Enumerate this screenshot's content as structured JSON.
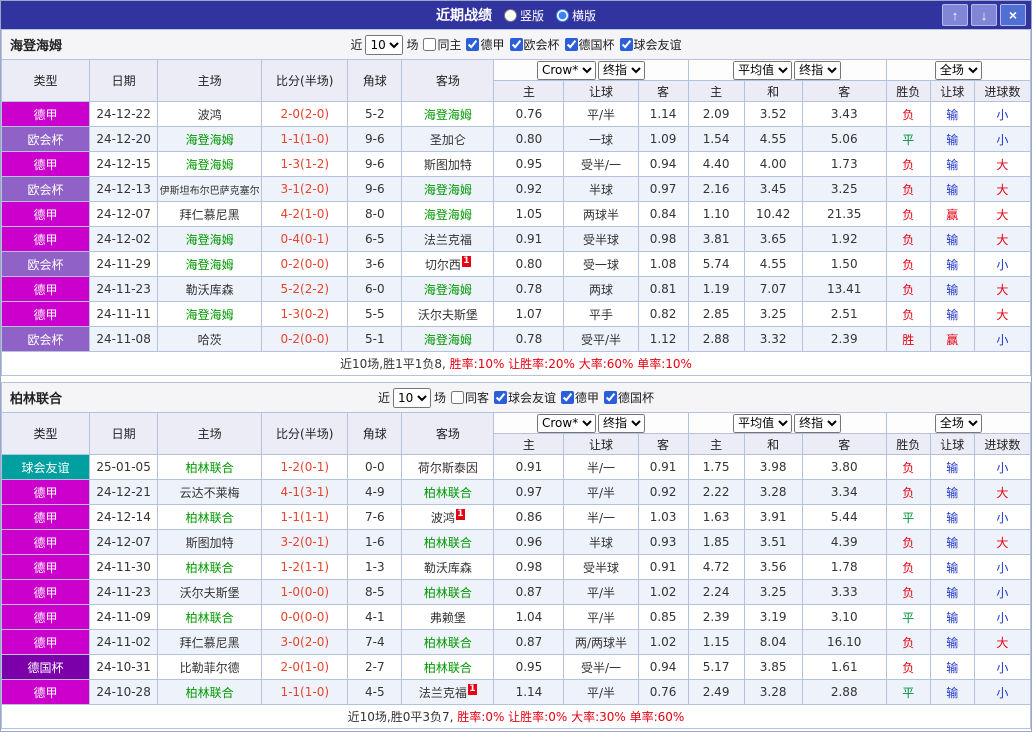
{
  "titlebar": {
    "title": "近期战绩",
    "radios": [
      {
        "label": "竖版",
        "selected": false
      },
      {
        "label": "横版",
        "selected": true
      }
    ],
    "buttons": {
      "up": "↑",
      "down": "↓",
      "close": "×"
    }
  },
  "colors": {
    "league": {
      "德甲": "#cc00cc",
      "欧会杯": "#9062c8",
      "德国杯": "#7b00aa",
      "球会友谊": "#00a0a0"
    },
    "team_highlight": "#009900",
    "score": "#e8432c",
    "result_map": {
      "胜": "red",
      "平": "green",
      "负": "red",
      "赢": "red",
      "输": "blue",
      "大": "red",
      "小": "blue"
    }
  },
  "table_header": {
    "static_cols": [
      "类型",
      "日期",
      "主场",
      "比分(半场)",
      "角球",
      "客场"
    ],
    "odds_groups": [
      {
        "selects": [
          "Crow*",
          "终指"
        ],
        "cols": [
          "主",
          "让球",
          "客"
        ]
      },
      {
        "selects": [
          "平均值",
          "终指"
        ],
        "cols": [
          "主",
          "和",
          "客"
        ]
      },
      {
        "selects": [
          "全场"
        ],
        "cols": [
          "胜负",
          "让球",
          "进球数"
        ]
      }
    ]
  },
  "sections": [
    {
      "team": "海登海姆",
      "filter": {
        "near_label": "近",
        "count": "10",
        "games_label": "场",
        "same_venue": {
          "label": "同主",
          "checked": false
        },
        "leagues": [
          {
            "label": "德甲",
            "checked": true
          },
          {
            "label": "欧会杯",
            "checked": true
          },
          {
            "label": "德国杯",
            "checked": true
          },
          {
            "label": "球会友谊",
            "checked": true
          }
        ]
      },
      "rows": [
        {
          "league": "德甲",
          "date": "24-12-22",
          "home": "波鸿",
          "home_hl": false,
          "score": "2-0(2-0)",
          "corner": "5-2",
          "away": "海登海姆",
          "away_hl": true,
          "crown": [
            "0.76",
            "平/半",
            "1.14"
          ],
          "avg": [
            "2.09",
            "3.52",
            "3.43"
          ],
          "result": [
            "负",
            "输",
            "小"
          ]
        },
        {
          "league": "欧会杯",
          "date": "24-12-20",
          "home": "海登海姆",
          "home_hl": true,
          "score": "1-1(1-0)",
          "corner": "9-6",
          "away": "圣加仑",
          "away_hl": false,
          "crown": [
            "0.80",
            "一球",
            "1.09"
          ],
          "avg": [
            "1.54",
            "4.55",
            "5.06"
          ],
          "result": [
            "平",
            "输",
            "小"
          ]
        },
        {
          "league": "德甲",
          "date": "24-12-15",
          "home": "海登海姆",
          "home_hl": true,
          "score": "1-3(1-2)",
          "corner": "9-6",
          "away": "斯图加特",
          "away_hl": false,
          "crown": [
            "0.95",
            "受半/一",
            "0.94"
          ],
          "avg": [
            "4.40",
            "4.00",
            "1.73"
          ],
          "result": [
            "负",
            "输",
            "大"
          ]
        },
        {
          "league": "欧会杯",
          "date": "24-12-13",
          "home": "伊斯坦布尔巴萨克塞尔",
          "home_hl": false,
          "score": "3-1(2-0)",
          "corner": "9-6",
          "away": "海登海姆",
          "away_hl": true,
          "crown": [
            "0.92",
            "半球",
            "0.97"
          ],
          "avg": [
            "2.16",
            "3.45",
            "3.25"
          ],
          "result": [
            "负",
            "输",
            "大"
          ]
        },
        {
          "league": "德甲",
          "date": "24-12-07",
          "home": "拜仁慕尼黑",
          "home_hl": false,
          "score": "4-2(1-0)",
          "corner": "8-0",
          "away": "海登海姆",
          "away_hl": true,
          "crown": [
            "1.05",
            "两球半",
            "0.84"
          ],
          "avg": [
            "1.10",
            "10.42",
            "21.35"
          ],
          "result": [
            "负",
            "赢",
            "大"
          ]
        },
        {
          "league": "德甲",
          "date": "24-12-02",
          "home": "海登海姆",
          "home_hl": true,
          "score": "0-4(0-1)",
          "corner": "6-5",
          "away": "法兰克福",
          "away_hl": false,
          "crown": [
            "0.91",
            "受半球",
            "0.98"
          ],
          "avg": [
            "3.81",
            "3.65",
            "1.92"
          ],
          "result": [
            "负",
            "输",
            "大"
          ]
        },
        {
          "league": "欧会杯",
          "date": "24-11-29",
          "home": "海登海姆",
          "home_hl": true,
          "score": "0-2(0-0)",
          "corner": "3-6",
          "away": "切尔西",
          "away_hl": false,
          "away_rc": "1",
          "crown": [
            "0.80",
            "受一球",
            "1.08"
          ],
          "avg": [
            "5.74",
            "4.55",
            "1.50"
          ],
          "result": [
            "负",
            "输",
            "小"
          ]
        },
        {
          "league": "德甲",
          "date": "24-11-23",
          "home": "勒沃库森",
          "home_hl": false,
          "score": "5-2(2-2)",
          "corner": "6-0",
          "away": "海登海姆",
          "away_hl": true,
          "crown": [
            "0.78",
            "两球",
            "0.81"
          ],
          "avg": [
            "1.19",
            "7.07",
            "13.41"
          ],
          "result": [
            "负",
            "输",
            "大"
          ]
        },
        {
          "league": "德甲",
          "date": "24-11-11",
          "home": "海登海姆",
          "home_hl": true,
          "score": "1-3(0-2)",
          "corner": "5-5",
          "away": "沃尔夫斯堡",
          "away_hl": false,
          "crown": [
            "1.07",
            "平手",
            "0.82"
          ],
          "avg": [
            "2.85",
            "3.25",
            "2.51"
          ],
          "result": [
            "负",
            "输",
            "大"
          ]
        },
        {
          "league": "欧会杯",
          "date": "24-11-08",
          "home": "哈茨",
          "home_hl": false,
          "score": "0-2(0-0)",
          "corner": "5-1",
          "away": "海登海姆",
          "away_hl": true,
          "crown": [
            "0.78",
            "受平/半",
            "1.12"
          ],
          "avg": [
            "2.88",
            "3.32",
            "2.39"
          ],
          "result": [
            "胜",
            "赢",
            "小"
          ]
        }
      ],
      "summary": {
        "record": "近10场,胜1平1负8,",
        "rates": "胜率:10% 让胜率:20% 大率:60% 单率:10%"
      }
    },
    {
      "team": "柏林联合",
      "filter": {
        "near_label": "近",
        "count": "10",
        "games_label": "场",
        "same_venue": {
          "label": "同客",
          "checked": false
        },
        "leagues": [
          {
            "label": "球会友谊",
            "checked": true
          },
          {
            "label": "德甲",
            "checked": true
          },
          {
            "label": "德国杯",
            "checked": true
          }
        ]
      },
      "rows": [
        {
          "league": "球会友谊",
          "date": "25-01-05",
          "home": "柏林联合",
          "home_hl": true,
          "score": "1-2(0-1)",
          "corner": "0-0",
          "away": "荷尔斯泰因",
          "away_hl": false,
          "crown": [
            "0.91",
            "半/一",
            "0.91"
          ],
          "avg": [
            "1.75",
            "3.98",
            "3.80"
          ],
          "result": [
            "负",
            "输",
            "小"
          ]
        },
        {
          "league": "德甲",
          "date": "24-12-21",
          "home": "云达不莱梅",
          "home_hl": false,
          "score": "4-1(3-1)",
          "corner": "4-9",
          "away": "柏林联合",
          "away_hl": true,
          "crown": [
            "0.97",
            "平/半",
            "0.92"
          ],
          "avg": [
            "2.22",
            "3.28",
            "3.34"
          ],
          "result": [
            "负",
            "输",
            "大"
          ]
        },
        {
          "league": "德甲",
          "date": "24-12-14",
          "home": "柏林联合",
          "home_hl": true,
          "score": "1-1(1-1)",
          "corner": "7-6",
          "away": "波鸿",
          "away_hl": false,
          "away_rc": "1",
          "crown": [
            "0.86",
            "半/一",
            "1.03"
          ],
          "avg": [
            "1.63",
            "3.91",
            "5.44"
          ],
          "result": [
            "平",
            "输",
            "小"
          ]
        },
        {
          "league": "德甲",
          "date": "24-12-07",
          "home": "斯图加特",
          "home_hl": false,
          "score": "3-2(0-1)",
          "corner": "1-6",
          "away": "柏林联合",
          "away_hl": true,
          "crown": [
            "0.96",
            "半球",
            "0.93"
          ],
          "avg": [
            "1.85",
            "3.51",
            "4.39"
          ],
          "result": [
            "负",
            "输",
            "大"
          ]
        },
        {
          "league": "德甲",
          "date": "24-11-30",
          "home": "柏林联合",
          "home_hl": true,
          "score": "1-2(1-1)",
          "corner": "1-3",
          "away": "勒沃库森",
          "away_hl": false,
          "crown": [
            "0.98",
            "受半球",
            "0.91"
          ],
          "avg": [
            "4.72",
            "3.56",
            "1.78"
          ],
          "result": [
            "负",
            "输",
            "小"
          ]
        },
        {
          "league": "德甲",
          "date": "24-11-23",
          "home": "沃尔夫斯堡",
          "home_hl": false,
          "score": "1-0(0-0)",
          "corner": "8-5",
          "away": "柏林联合",
          "away_hl": true,
          "crown": [
            "0.87",
            "平/半",
            "1.02"
          ],
          "avg": [
            "2.24",
            "3.25",
            "3.33"
          ],
          "result": [
            "负",
            "输",
            "小"
          ]
        },
        {
          "league": "德甲",
          "date": "24-11-09",
          "home": "柏林联合",
          "home_hl": true,
          "score": "0-0(0-0)",
          "corner": "4-1",
          "away": "弗赖堡",
          "away_hl": false,
          "crown": [
            "1.04",
            "平/半",
            "0.85"
          ],
          "avg": [
            "2.39",
            "3.19",
            "3.10"
          ],
          "result": [
            "平",
            "输",
            "小"
          ]
        },
        {
          "league": "德甲",
          "date": "24-11-02",
          "home": "拜仁慕尼黑",
          "home_hl": false,
          "score": "3-0(2-0)",
          "corner": "7-4",
          "away": "柏林联合",
          "away_hl": true,
          "crown": [
            "0.87",
            "两/两球半",
            "1.02"
          ],
          "avg": [
            "1.15",
            "8.04",
            "16.10"
          ],
          "result": [
            "负",
            "输",
            "大"
          ]
        },
        {
          "league": "德国杯",
          "date": "24-10-31",
          "home": "比勒菲尔德",
          "home_hl": false,
          "score": "2-0(1-0)",
          "corner": "2-7",
          "away": "柏林联合",
          "away_hl": true,
          "crown": [
            "0.95",
            "受半/一",
            "0.94"
          ],
          "avg": [
            "5.17",
            "3.85",
            "1.61"
          ],
          "result": [
            "负",
            "输",
            "小"
          ]
        },
        {
          "league": "德甲",
          "date": "24-10-28",
          "home": "柏林联合",
          "home_hl": true,
          "score": "1-1(1-0)",
          "corner": "4-5",
          "away": "法兰克福",
          "away_hl": false,
          "away_rc": "1",
          "crown": [
            "1.14",
            "平/半",
            "0.76"
          ],
          "avg": [
            "2.49",
            "3.28",
            "2.88"
          ],
          "result": [
            "平",
            "输",
            "小"
          ]
        }
      ],
      "summary": {
        "record": "近10场,胜0平3负7,",
        "rates": "胜率:0% 让胜率:0% 大率:30% 单率:60%"
      }
    }
  ]
}
